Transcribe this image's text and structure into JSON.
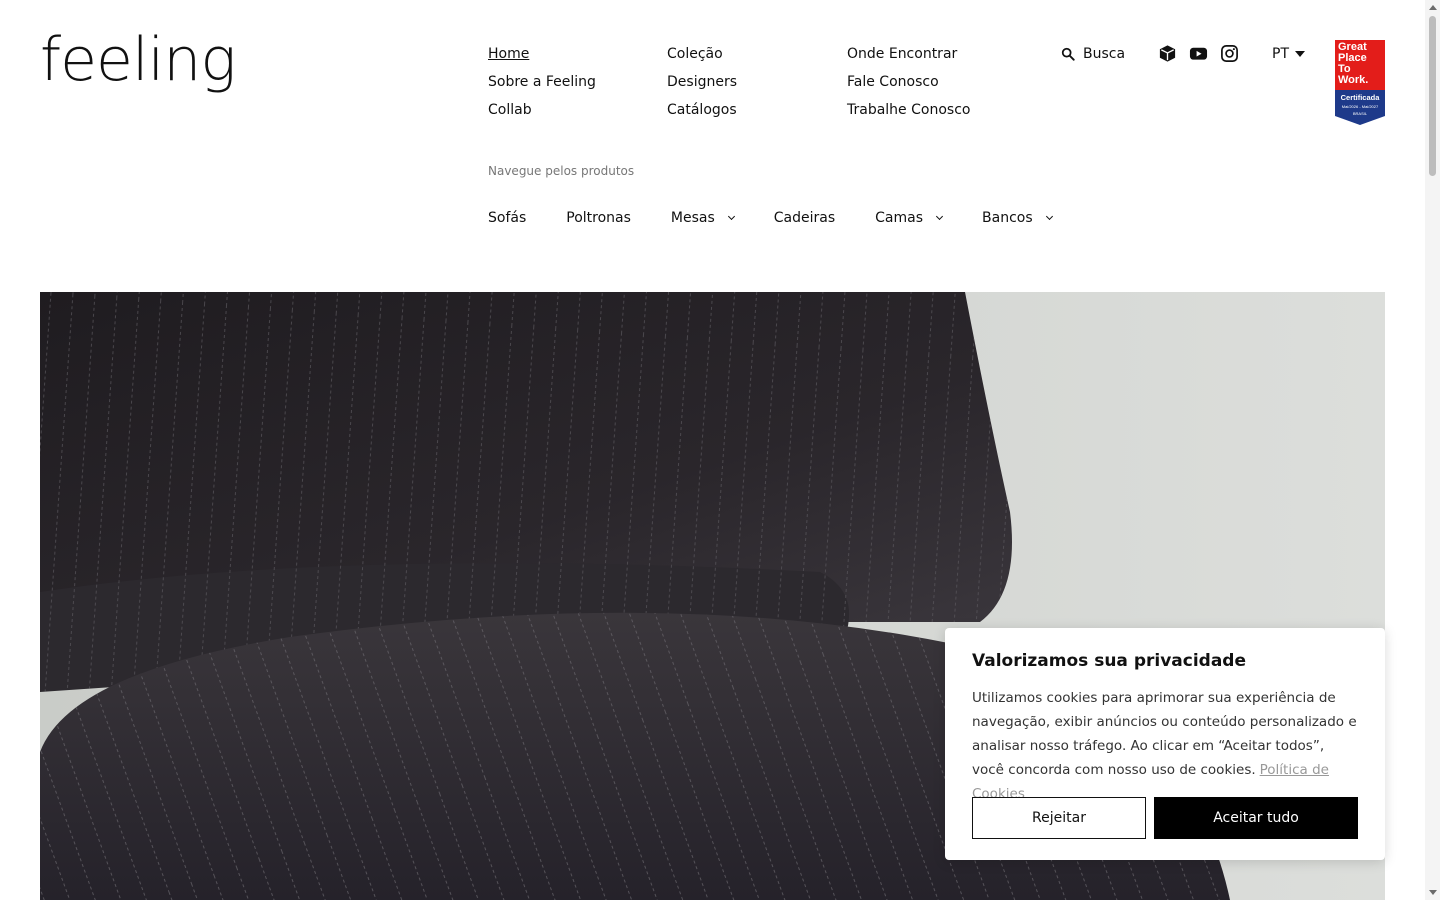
{
  "brand": {
    "logo": "feeling"
  },
  "nav": {
    "col1": [
      "Home",
      "Sobre a Feeling",
      "Collab"
    ],
    "col2": [
      "Coleção",
      "Designers",
      "Catálogos"
    ],
    "col3": [
      "Onde Encontrar",
      "Fale Conosco",
      "Trabalhe Conosco"
    ]
  },
  "search": {
    "label": "Busca",
    "icon": "search-icon"
  },
  "social": {
    "icons": [
      "cube-icon",
      "youtube-icon",
      "instagram-icon"
    ]
  },
  "language": {
    "current": "PT"
  },
  "badge": {
    "lines": [
      "Great",
      "Place",
      "To",
      "Work."
    ],
    "certified": "Certificada",
    "period": "Mai/2026 - Mai/2027",
    "country": "BRASIL"
  },
  "products": {
    "label": "Navegue pelos produtos",
    "items": [
      "Sofás",
      "Poltronas",
      "Mesas",
      "Cadeiras",
      "Camas",
      "Bancos"
    ]
  },
  "cookie": {
    "title": "Valorizamos sua privacidade",
    "text": "Utilizamos cookies para aprimorar sua experiência de navegação, exibir anúncios ou conteúdo personalizado e analisar nosso tráfego. Ao clicar em “Aceitar todos”, você concorda com nosso uso de cookies.",
    "link": "Política de Cookies",
    "reject": "Rejeitar",
    "accept": "Aceitar tudo"
  },
  "colors": {
    "badge_red": "#e31d1a",
    "badge_blue": "#1e3a8a",
    "fabric": "#2b272b",
    "background": "#d4d7d3"
  }
}
